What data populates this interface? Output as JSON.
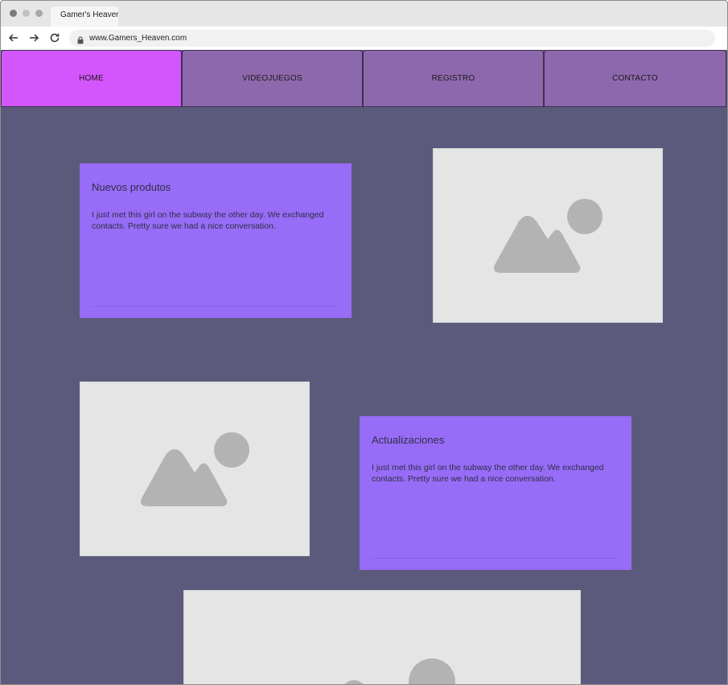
{
  "browser": {
    "tab_title": "Gamer's Heaven",
    "url": "www.Gamers_Heaven.com"
  },
  "nav": {
    "items": [
      {
        "label": "HOME",
        "active": true
      },
      {
        "label": "VIDEOJUEGOS",
        "active": false
      },
      {
        "label": "REGISTRO",
        "active": false
      },
      {
        "label": "CONTACTO",
        "active": false
      }
    ]
  },
  "cards": [
    {
      "title": "Nuevos produtos",
      "body": "I just met this girl on the subway the other day. We exchanged contacts. Pretty sure we had a nice conversation."
    },
    {
      "title": "Actualizaciones",
      "body": "I just met this girl on the subway the other day. We exchanged contacts. Pretty sure we had a nice conversation."
    }
  ],
  "colors": {
    "page_background": "#5c5a7c",
    "nav_active": "#d355fc",
    "nav_inactive": "#8e68ad",
    "card": "#976cf6",
    "image_placeholder": "#e5e5e5",
    "placeholder_glyph": "#b3b3b3"
  },
  "icons": {
    "image_placeholder": "image-placeholder-icon",
    "lock": "lock-icon",
    "back": "arrow-left-icon",
    "forward": "arrow-right-icon",
    "reload": "reload-icon"
  }
}
